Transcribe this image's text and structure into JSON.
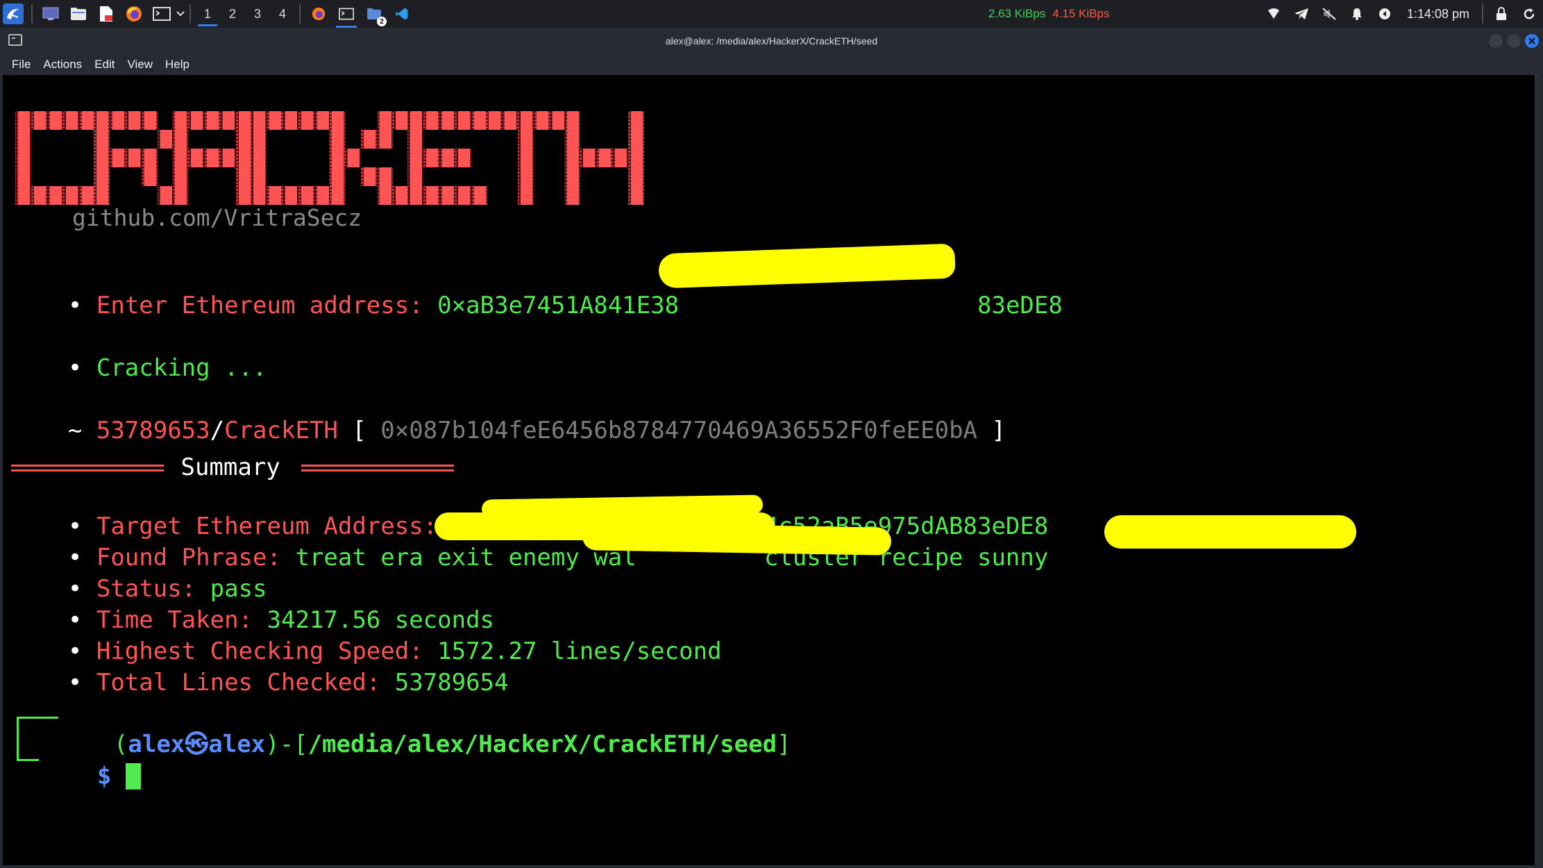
{
  "panel": {
    "workspaces": [
      "1",
      "2",
      "3",
      "4"
    ],
    "active_workspace": "1",
    "net_down": "2.63 KiBps",
    "net_up": "4.15 KiBps",
    "clock": "1:14:08 pm",
    "badge": "2"
  },
  "window": {
    "title": "alex@alex: /media/alex/HackerX/CrackETH/seed",
    "menu": [
      "File",
      "Actions",
      "Edit",
      "View",
      "Help"
    ]
  },
  "terminal": {
    "banner_text": "CRACKETH",
    "github": "github.com/VritraSecz",
    "bullet": "•",
    "enter_label": "Enter Ethereum address: ",
    "enter_value_prefix": "0×aB3e7451A841E38",
    "enter_value_suffix": "83eDE8",
    "cracking": "Cracking ...",
    "tilde": "~ ",
    "counter": "53789653",
    "slash": "/",
    "tool": "CrackETH",
    "bracket_open": " [ ",
    "candidate": "0×087b104feE6456b8784770469A36552F0feEE0bA",
    "bracket_close": " ]",
    "summary_title": " Summary ",
    "rows": [
      {
        "label": "Target Ethereum Address: ",
        "value": "0×aB3e7451A841E3855E2d4c52aB5e975dAB83eDE8"
      },
      {
        "label": "Found Phrase: ",
        "value": "treat era exit enemy wal         cluster recipe sunny"
      },
      {
        "label": "Status: ",
        "value": "pass"
      },
      {
        "label": "Time Taken: ",
        "value": "34217.56 seconds"
      },
      {
        "label": "Highest Checking Speed: ",
        "value": "1572.27 lines/second"
      },
      {
        "label": "Total Lines Checked: ",
        "value": "53789654"
      }
    ],
    "prompt_user": "alex",
    "prompt_at": "㉿",
    "prompt_host": "alex",
    "prompt_path": "/media/alex/HackerX/CrackETH/seed",
    "prompt_symbol": "$"
  },
  "colors": {
    "banner_red": "#ff5454",
    "terminal_green": "#4eea4e",
    "redaction": "#ffff00",
    "accent_blue": "#367bf0"
  },
  "icons": [
    "kali-menu-icon",
    "desktop-icon",
    "file-manager-icon",
    "text-editor-icon",
    "firefox-icon",
    "terminal-icon",
    "vscode-icon",
    "wifi-icon",
    "telegram-icon",
    "mute-icon",
    "bell-icon",
    "power-icon",
    "lock-icon",
    "refresh-icon"
  ]
}
